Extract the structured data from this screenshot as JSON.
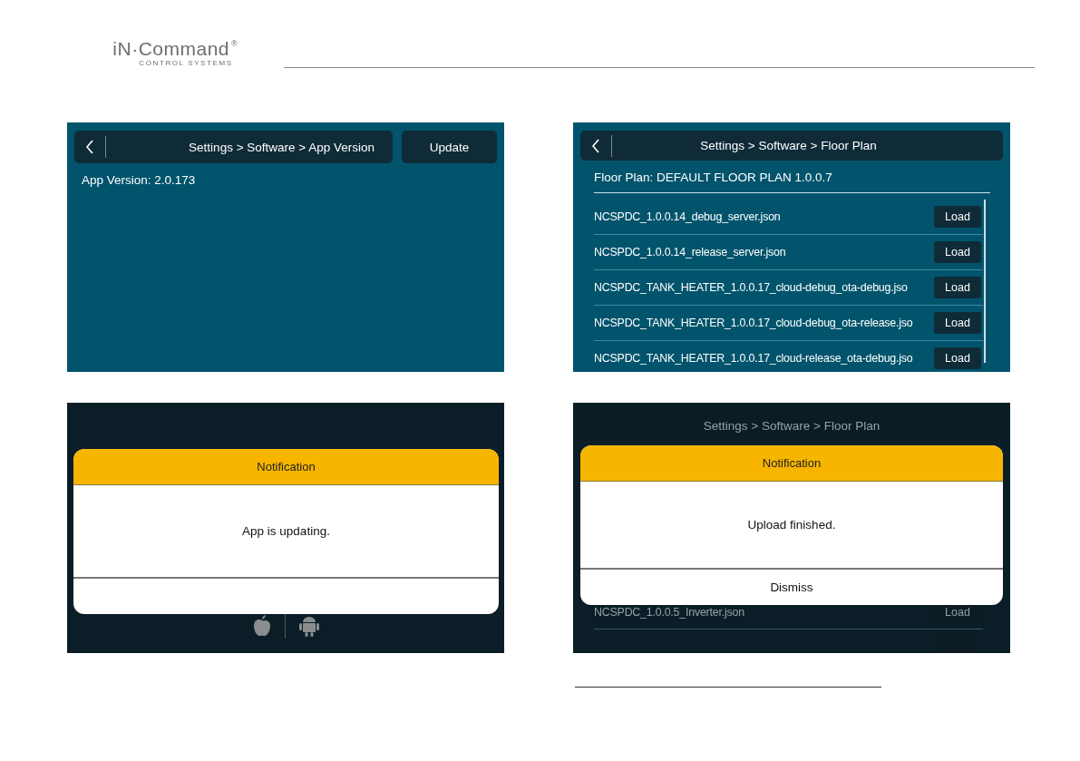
{
  "header": {
    "logo": {
      "name": "iN·Command",
      "mark": "®",
      "tagline": "CONTROL SYSTEMS"
    }
  },
  "screens": [
    {
      "kind": "app_version",
      "breadcrumb": "Settings > Software > App Version",
      "action": "Update",
      "info": "App Version: 2.0.173"
    },
    {
      "kind": "floor_plan",
      "breadcrumb": "Settings > Software > Floor Plan",
      "info": "Floor Plan: DEFAULT FLOOR PLAN 1.0.0.7",
      "files": [
        {
          "name": "NCSPDC_1.0.0.14_debug_server.json",
          "button": "Load"
        },
        {
          "name": "NCSPDC_1.0.0.14_release_server.json",
          "button": "Load"
        },
        {
          "name": "NCSPDC_TANK_HEATER_1.0.0.17_cloud-debug_ota-debug.jso",
          "button": "Load"
        },
        {
          "name": "NCSPDC_TANK_HEATER_1.0.0.17_cloud-debug_ota-release.jso",
          "button": "Load"
        },
        {
          "name": "NCSPDC_TANK_HEATER_1.0.0.17_cloud-release_ota-debug.jso",
          "button": "Load"
        }
      ]
    },
    {
      "kind": "splash",
      "dialog": {
        "title": "Notification",
        "message": "App is updating."
      }
    },
    {
      "kind": "floor_plan_dialog",
      "breadcrumb": "Settings > Software > Floor Plan",
      "files": [
        {
          "name": "NCSPDC_1.0.0.5_Inverter.json",
          "button": "Load"
        }
      ],
      "dialog": {
        "title": "Notification",
        "message": "Upload finished.",
        "button": "Dismiss"
      }
    }
  ]
}
